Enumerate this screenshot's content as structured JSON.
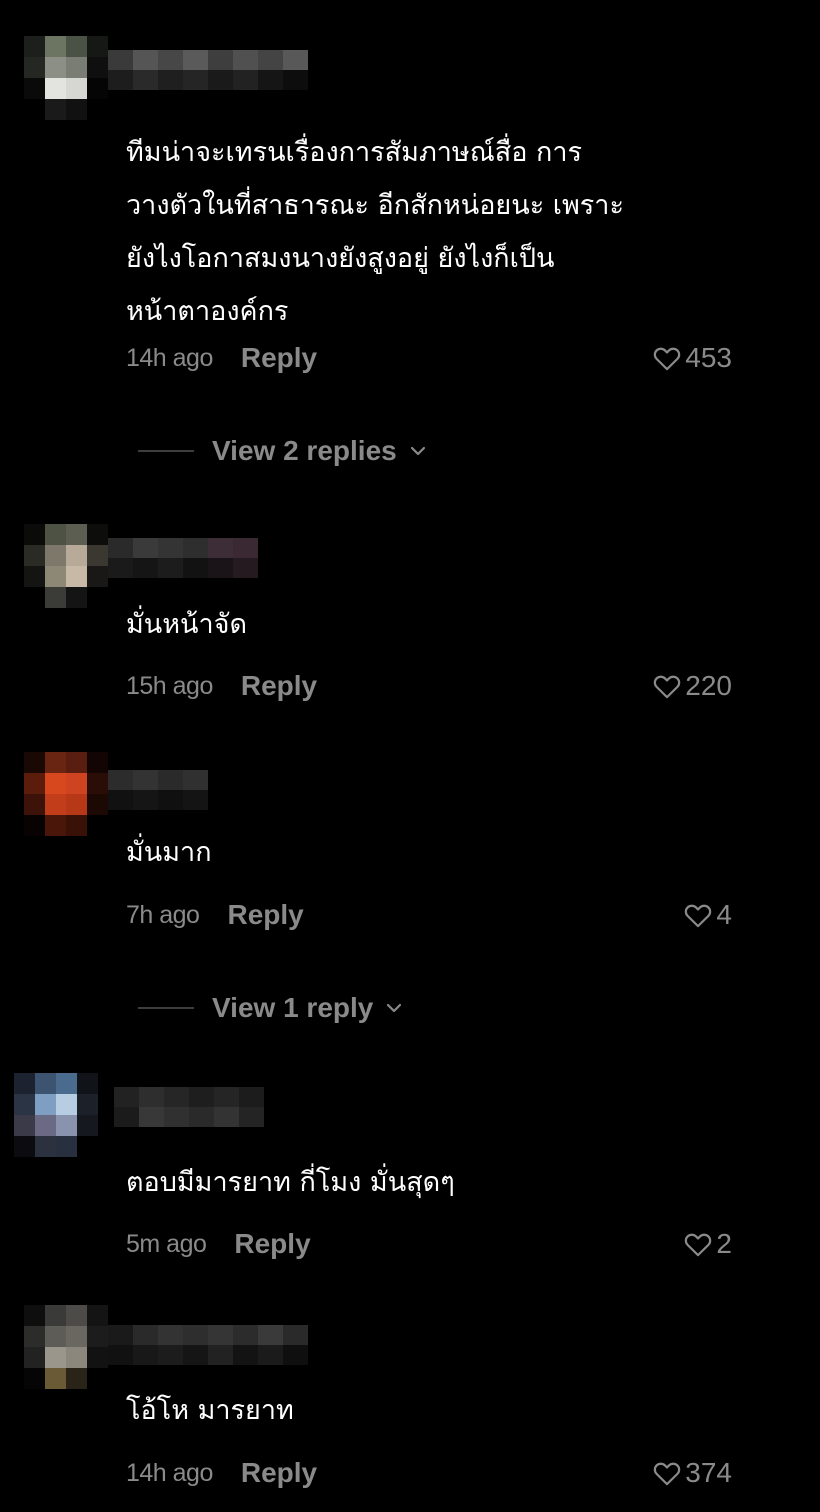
{
  "colors": {
    "background": "#000000",
    "text": "#ffffff",
    "muted": "#8a8a8a",
    "divider": "#3d3d3d"
  },
  "comments": [
    {
      "lines": [
        "ทีมน่าจะเทรนเรื่องการสัมภาษณ์สื่อ การ",
        "วางตัวในที่สาธารณะ อีกสักหน่อยนะ เพราะ",
        "ยังไงโอกาสมงนางยังสูงอยู่ ยังไงก็เป็น",
        "หน้าตาองค์กร"
      ],
      "time": "14h ago",
      "reply": "Reply",
      "likes": "453",
      "like_icon": "heart-outline-icon"
    },
    {
      "lines": [
        "มั่นหน้าจัด"
      ],
      "time": "15h ago",
      "reply": "Reply",
      "likes": "220",
      "like_icon": "heart-outline-icon"
    },
    {
      "lines": [
        "มั่นมาก"
      ],
      "time": "7h ago",
      "reply": "Reply",
      "likes": "4",
      "like_icon": "heart-outline-icon"
    },
    {
      "lines": [
        "ตอบมีมารยาท กี่โมง มั่นสุดๆ"
      ],
      "time": "5m ago",
      "reply": "Reply",
      "likes": "2",
      "like_icon": "heart-outline-icon"
    },
    {
      "lines": [
        "โอ้โห มารยาท"
      ],
      "time": "14h ago",
      "reply": "Reply",
      "likes": "374",
      "like_icon": "heart-outline-icon"
    }
  ],
  "view_replies": [
    {
      "label": "View 2 replies",
      "icon": "chevron-down-icon"
    },
    {
      "label": "View 1 reply",
      "icon": "chevron-down-icon"
    }
  ]
}
